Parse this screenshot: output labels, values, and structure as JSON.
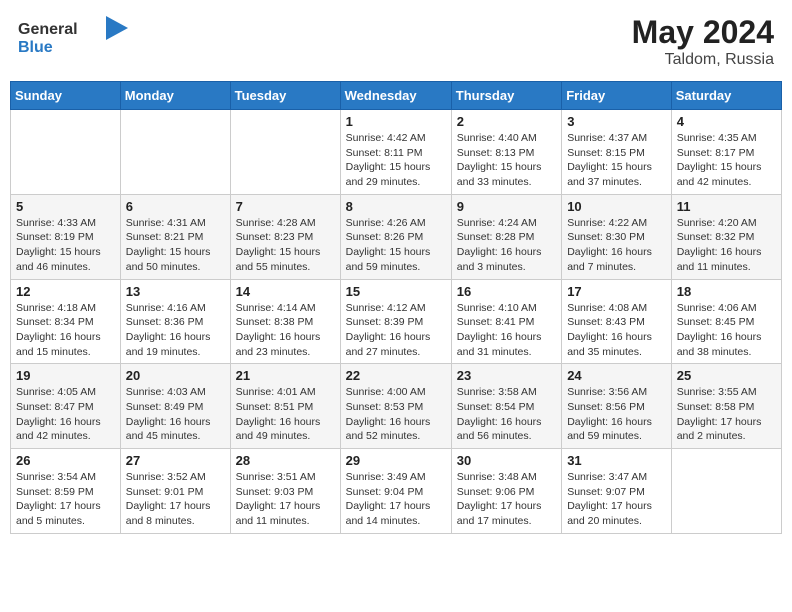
{
  "header": {
    "logo_general": "General",
    "logo_blue": "Blue",
    "month_year": "May 2024",
    "location": "Taldom, Russia"
  },
  "weekdays": [
    "Sunday",
    "Monday",
    "Tuesday",
    "Wednesday",
    "Thursday",
    "Friday",
    "Saturday"
  ],
  "weeks": [
    [
      {
        "day": "",
        "info": ""
      },
      {
        "day": "",
        "info": ""
      },
      {
        "day": "",
        "info": ""
      },
      {
        "day": "1",
        "info": "Sunrise: 4:42 AM\nSunset: 8:11 PM\nDaylight: 15 hours\nand 29 minutes."
      },
      {
        "day": "2",
        "info": "Sunrise: 4:40 AM\nSunset: 8:13 PM\nDaylight: 15 hours\nand 33 minutes."
      },
      {
        "day": "3",
        "info": "Sunrise: 4:37 AM\nSunset: 8:15 PM\nDaylight: 15 hours\nand 37 minutes."
      },
      {
        "day": "4",
        "info": "Sunrise: 4:35 AM\nSunset: 8:17 PM\nDaylight: 15 hours\nand 42 minutes."
      }
    ],
    [
      {
        "day": "5",
        "info": "Sunrise: 4:33 AM\nSunset: 8:19 PM\nDaylight: 15 hours\nand 46 minutes."
      },
      {
        "day": "6",
        "info": "Sunrise: 4:31 AM\nSunset: 8:21 PM\nDaylight: 15 hours\nand 50 minutes."
      },
      {
        "day": "7",
        "info": "Sunrise: 4:28 AM\nSunset: 8:23 PM\nDaylight: 15 hours\nand 55 minutes."
      },
      {
        "day": "8",
        "info": "Sunrise: 4:26 AM\nSunset: 8:26 PM\nDaylight: 15 hours\nand 59 minutes."
      },
      {
        "day": "9",
        "info": "Sunrise: 4:24 AM\nSunset: 8:28 PM\nDaylight: 16 hours\nand 3 minutes."
      },
      {
        "day": "10",
        "info": "Sunrise: 4:22 AM\nSunset: 8:30 PM\nDaylight: 16 hours\nand 7 minutes."
      },
      {
        "day": "11",
        "info": "Sunrise: 4:20 AM\nSunset: 8:32 PM\nDaylight: 16 hours\nand 11 minutes."
      }
    ],
    [
      {
        "day": "12",
        "info": "Sunrise: 4:18 AM\nSunset: 8:34 PM\nDaylight: 16 hours\nand 15 minutes."
      },
      {
        "day": "13",
        "info": "Sunrise: 4:16 AM\nSunset: 8:36 PM\nDaylight: 16 hours\nand 19 minutes."
      },
      {
        "day": "14",
        "info": "Sunrise: 4:14 AM\nSunset: 8:38 PM\nDaylight: 16 hours\nand 23 minutes."
      },
      {
        "day": "15",
        "info": "Sunrise: 4:12 AM\nSunset: 8:39 PM\nDaylight: 16 hours\nand 27 minutes."
      },
      {
        "day": "16",
        "info": "Sunrise: 4:10 AM\nSunset: 8:41 PM\nDaylight: 16 hours\nand 31 minutes."
      },
      {
        "day": "17",
        "info": "Sunrise: 4:08 AM\nSunset: 8:43 PM\nDaylight: 16 hours\nand 35 minutes."
      },
      {
        "day": "18",
        "info": "Sunrise: 4:06 AM\nSunset: 8:45 PM\nDaylight: 16 hours\nand 38 minutes."
      }
    ],
    [
      {
        "day": "19",
        "info": "Sunrise: 4:05 AM\nSunset: 8:47 PM\nDaylight: 16 hours\nand 42 minutes."
      },
      {
        "day": "20",
        "info": "Sunrise: 4:03 AM\nSunset: 8:49 PM\nDaylight: 16 hours\nand 45 minutes."
      },
      {
        "day": "21",
        "info": "Sunrise: 4:01 AM\nSunset: 8:51 PM\nDaylight: 16 hours\nand 49 minutes."
      },
      {
        "day": "22",
        "info": "Sunrise: 4:00 AM\nSunset: 8:53 PM\nDaylight: 16 hours\nand 52 minutes."
      },
      {
        "day": "23",
        "info": "Sunrise: 3:58 AM\nSunset: 8:54 PM\nDaylight: 16 hours\nand 56 minutes."
      },
      {
        "day": "24",
        "info": "Sunrise: 3:56 AM\nSunset: 8:56 PM\nDaylight: 16 hours\nand 59 minutes."
      },
      {
        "day": "25",
        "info": "Sunrise: 3:55 AM\nSunset: 8:58 PM\nDaylight: 17 hours\nand 2 minutes."
      }
    ],
    [
      {
        "day": "26",
        "info": "Sunrise: 3:54 AM\nSunset: 8:59 PM\nDaylight: 17 hours\nand 5 minutes."
      },
      {
        "day": "27",
        "info": "Sunrise: 3:52 AM\nSunset: 9:01 PM\nDaylight: 17 hours\nand 8 minutes."
      },
      {
        "day": "28",
        "info": "Sunrise: 3:51 AM\nSunset: 9:03 PM\nDaylight: 17 hours\nand 11 minutes."
      },
      {
        "day": "29",
        "info": "Sunrise: 3:49 AM\nSunset: 9:04 PM\nDaylight: 17 hours\nand 14 minutes."
      },
      {
        "day": "30",
        "info": "Sunrise: 3:48 AM\nSunset: 9:06 PM\nDaylight: 17 hours\nand 17 minutes."
      },
      {
        "day": "31",
        "info": "Sunrise: 3:47 AM\nSunset: 9:07 PM\nDaylight: 17 hours\nand 20 minutes."
      },
      {
        "day": "",
        "info": ""
      }
    ]
  ]
}
